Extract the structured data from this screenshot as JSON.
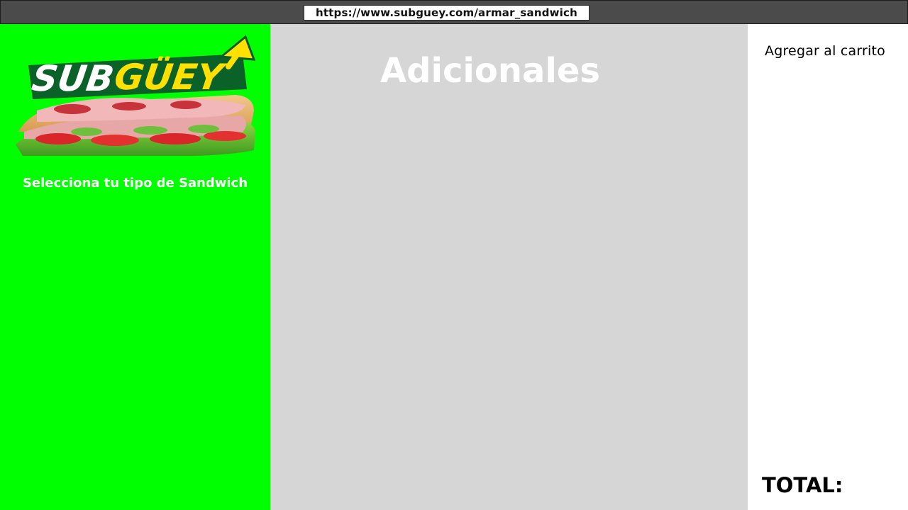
{
  "browser": {
    "url": "https://www.subguey.com/armar_sandwich"
  },
  "sidebar": {
    "logo_text": "SUBGÜEY",
    "logo_sub": "SUB",
    "logo_brand": "GÜEY",
    "prompt": "Selecciona tu tipo de Sandwich",
    "background_color": "#00ff00"
  },
  "main": {
    "title": "Adicionales",
    "background_color": "#d6d6d6"
  },
  "cart": {
    "add_label": "Agregar al carrito",
    "total_label": "TOTAL:"
  },
  "icons": {
    "logo_arrow": "arrow-right-icon"
  }
}
